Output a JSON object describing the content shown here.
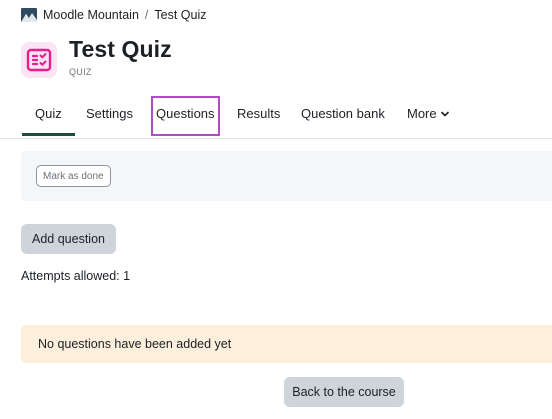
{
  "breadcrumb": {
    "site": "Moodle Mountain",
    "separator": "/",
    "current": "Test Quiz"
  },
  "header": {
    "title": "Test Quiz",
    "activity_type": "QUIZ",
    "icon": "quiz-icon",
    "icon_color": "#e91e8c",
    "icon_bg": "#fbe4f3"
  },
  "tabs": [
    {
      "label": "Quiz",
      "active": true
    },
    {
      "label": "Settings",
      "active": false
    },
    {
      "label": "Questions",
      "active": false,
      "highlighted": true
    },
    {
      "label": "Results",
      "active": false
    },
    {
      "label": "Question bank",
      "active": false
    },
    {
      "label": "More",
      "active": false,
      "icon": "chevron-down-icon"
    }
  ],
  "completion": {
    "mark_done_label": "Mark as done"
  },
  "actions": {
    "add_question_label": "Add question",
    "back_label": "Back to the course"
  },
  "info": {
    "attempts": "Attempts allowed: 1"
  },
  "notice": {
    "text": "No questions have been added yet"
  },
  "colors": {
    "highlight": "#b04cc8",
    "active_tab_underline": "#1d4e3a",
    "alert_bg": "#fcefdc",
    "button_bg": "#ced4da"
  }
}
